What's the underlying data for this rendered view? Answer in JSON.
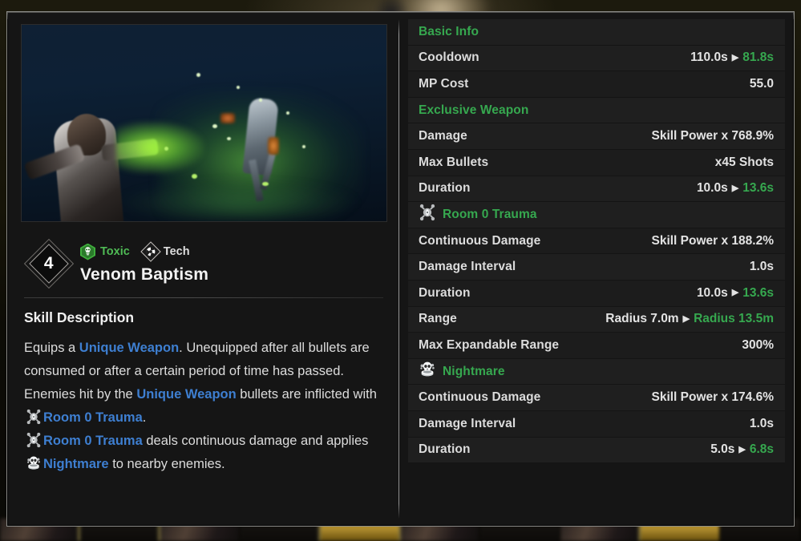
{
  "skill": {
    "level": "4",
    "name": "Venom Baptism",
    "tags": [
      {
        "label": "Toxic",
        "icon": "toxic-hex-icon",
        "color": "#4fbb55"
      },
      {
        "label": "Tech",
        "icon": "tech-diamond-icon",
        "color": "#dedede"
      }
    ],
    "preview_alt": "skill-preview-video"
  },
  "description": {
    "title": "Skill Description",
    "paragraphs": [
      {
        "segments": [
          {
            "text": "Equips a ",
            "style": "normal"
          },
          {
            "text": "Unique Weapon",
            "style": "keyword-blue"
          },
          {
            "text": ". Unequipped after all bullets are consumed or after a certain period of time has passed.",
            "style": "normal"
          }
        ]
      },
      {
        "segments": [
          {
            "text": "Enemies hit by the ",
            "style": "normal"
          },
          {
            "text": "Unique Weapon",
            "style": "keyword-blue"
          },
          {
            "text": " bullets are inflicted with ",
            "style": "normal"
          },
          {
            "text": "",
            "style": "icon",
            "icon": "room-0-trauma-icon"
          },
          {
            "text": "Room 0 Trauma",
            "style": "keyword-blue"
          },
          {
            "text": ".",
            "style": "normal"
          }
        ]
      },
      {
        "segments": [
          {
            "text": "",
            "style": "icon",
            "icon": "room-0-trauma-icon"
          },
          {
            "text": "Room 0 Trauma",
            "style": "keyword-blue"
          },
          {
            "text": " deals continuous damage and applies ",
            "style": "normal"
          },
          {
            "text": "",
            "style": "icon",
            "icon": "nightmare-icon"
          },
          {
            "text": "Nightmare",
            "style": "keyword-blue"
          },
          {
            "text": " to nearby enemies.",
            "style": "normal"
          }
        ]
      }
    ]
  },
  "stats": {
    "sections": [
      {
        "title": "Basic Info",
        "icon": null,
        "rows": [
          {
            "label": "Cooldown",
            "base": "110.0s",
            "upgraded": "81.8s",
            "arrow": true
          },
          {
            "label": "MP Cost",
            "base": "55.0",
            "upgraded": null,
            "arrow": false
          }
        ]
      },
      {
        "title": "Exclusive Weapon",
        "icon": null,
        "rows": [
          {
            "label": "Damage",
            "base": "Skill Power x 768.9%",
            "upgraded": null,
            "arrow": false
          },
          {
            "label": "Max Bullets",
            "base": "x45 Shots",
            "upgraded": null,
            "arrow": false
          },
          {
            "label": "Duration",
            "base": "10.0s",
            "upgraded": "13.6s",
            "arrow": true
          }
        ]
      },
      {
        "title": "Room 0 Trauma",
        "icon": "room-0-trauma-icon",
        "rows": [
          {
            "label": "Continuous Damage",
            "base": "Skill Power x 188.2%",
            "upgraded": null,
            "arrow": false
          },
          {
            "label": "Damage Interval",
            "base": "1.0s",
            "upgraded": null,
            "arrow": false
          },
          {
            "label": "Duration",
            "base": "10.0s",
            "upgraded": "13.6s",
            "arrow": true
          },
          {
            "label": "Range",
            "base": "Radius 7.0m",
            "upgraded": "Radius 13.5m",
            "arrow": true
          },
          {
            "label": "Max Expandable Range",
            "base": "300%",
            "upgraded": null,
            "arrow": false
          }
        ]
      },
      {
        "title": "Nightmare",
        "icon": "nightmare-icon",
        "rows": [
          {
            "label": "Continuous Damage",
            "base": "Skill Power x 174.6%",
            "upgraded": null,
            "arrow": false
          },
          {
            "label": "Damage Interval",
            "base": "1.0s",
            "upgraded": null,
            "arrow": false
          },
          {
            "label": "Duration",
            "base": "5.0s",
            "upgraded": "6.8s",
            "arrow": true
          }
        ]
      }
    ]
  },
  "colors": {
    "green": "#36a84f",
    "keyword_blue": "#3e7fd1",
    "row_bg": "#1f1f1f",
    "text": "#dcdcdc"
  }
}
